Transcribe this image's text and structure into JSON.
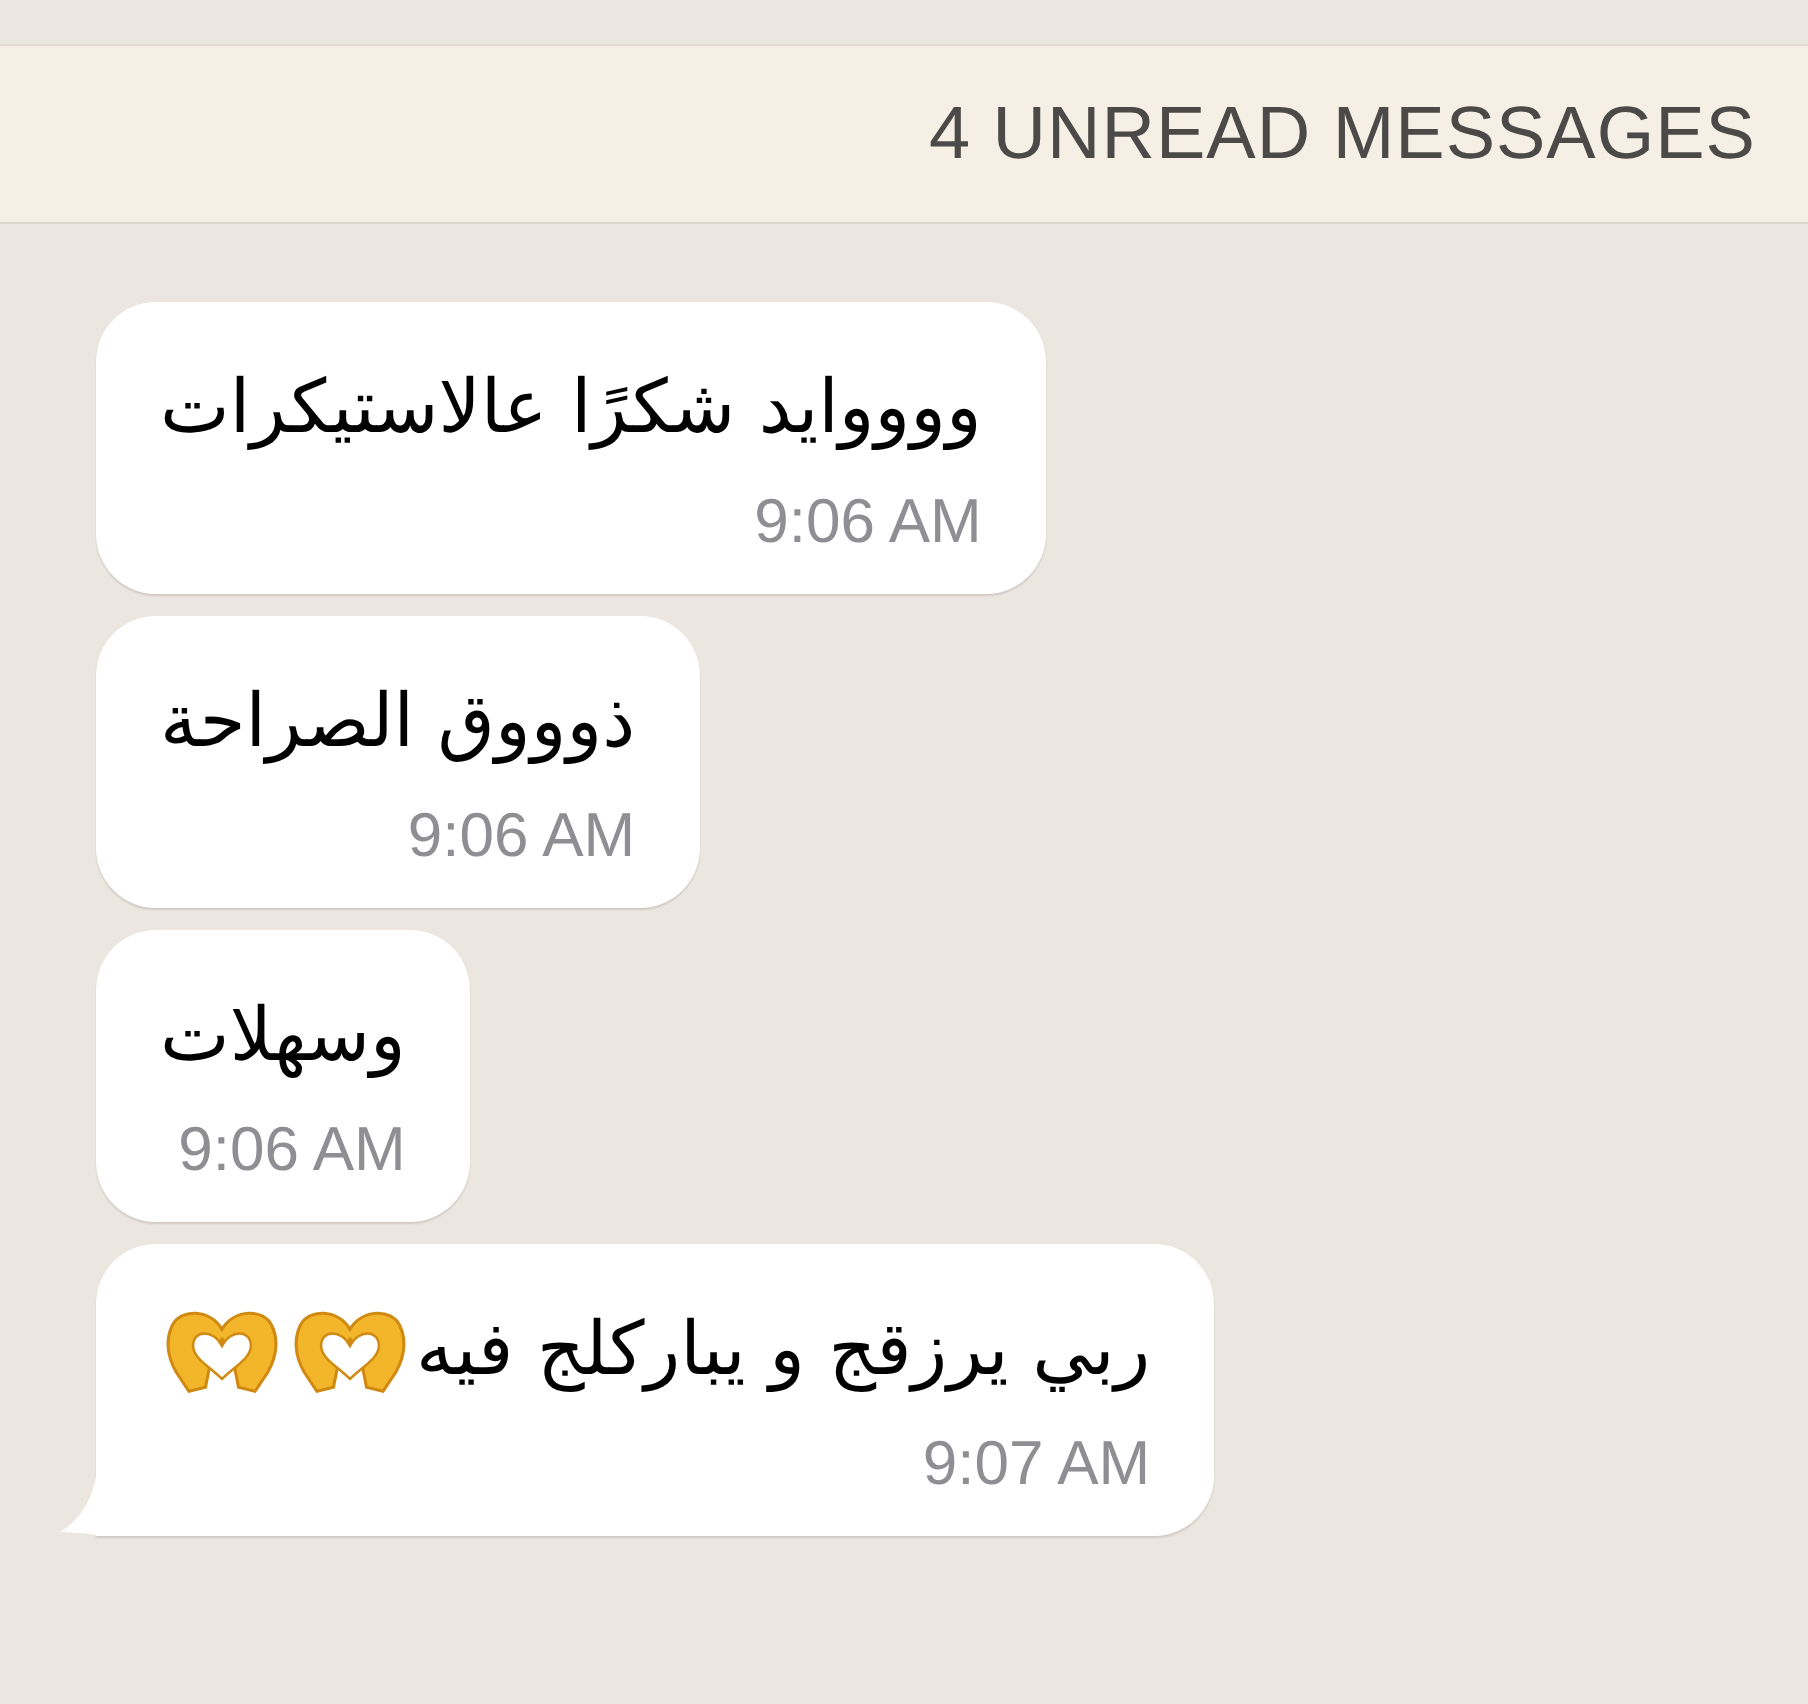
{
  "unread_banner": {
    "label": "4 UNREAD MESSAGES"
  },
  "messages": [
    {
      "text": "وووواید شكرًا عالاستيكرات",
      "time": "9:06 AM",
      "tail": false
    },
    {
      "text": "ذوووق الصراحة",
      "time": "9:06 AM",
      "tail": false
    },
    {
      "text": "وسهلات",
      "time": "9:06 AM",
      "tail": false
    },
    {
      "text": "ربي يرزقج و يباركلج فيه",
      "time": "9:07 AM",
      "tail": true,
      "trailing_icons": [
        {
          "kind": "heart_hands"
        },
        {
          "kind": "heart_hands"
        }
      ]
    }
  ]
}
